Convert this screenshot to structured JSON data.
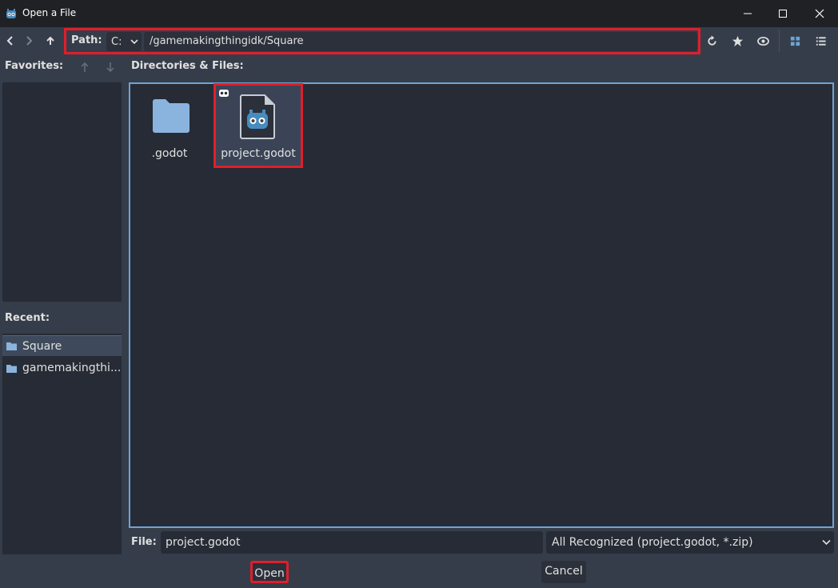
{
  "window": {
    "title": "Open a File",
    "controls": [
      "minimize-icon",
      "maximize-icon",
      "close-icon"
    ]
  },
  "toolbar": {
    "path_label": "Path:",
    "drive": "C:",
    "path_value": "/gamemakingthingidk/Square",
    "icons": [
      "back-icon",
      "forward-icon",
      "up-icon",
      "refresh-icon",
      "favorite-star-icon",
      "toggle-hidden-eye-icon",
      "grid-view-icon",
      "list-view-icon"
    ]
  },
  "favorites": {
    "label": "Favorites:",
    "items": []
  },
  "recent": {
    "label": "Recent:",
    "items": [
      {
        "label": "Square",
        "selected": true
      },
      {
        "label": "gamemakingthi...",
        "selected": false
      }
    ]
  },
  "files": {
    "label": "Directories & Files:",
    "items": [
      {
        "name": ".godot",
        "type": "folder",
        "selected": false
      },
      {
        "name": "project.godot",
        "type": "godot-project",
        "selected": true
      }
    ]
  },
  "bottom": {
    "file_label": "File:",
    "file_value": "project.godot",
    "filter_value": "All Recognized (project.godot, *.zip)",
    "open_label": "Open",
    "cancel_label": "Cancel"
  },
  "colors": {
    "highlight": "#e01e2b",
    "accent": "#6fa4d4",
    "folder": "#8ab4de"
  }
}
